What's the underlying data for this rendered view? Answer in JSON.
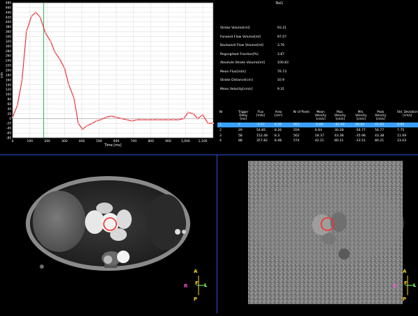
{
  "chart_data": {
    "type": "line",
    "title": "",
    "xlabel": "Time [ms]",
    "ylabel": "ml/s",
    "xlim": [
      0,
      1160
    ],
    "ylim": [
      -80,
      480
    ],
    "x_ticks": [
      0,
      100,
      200,
      300,
      400,
      500,
      600,
      700,
      800,
      900,
      1000,
      1100
    ],
    "x_tick_labels": [
      "0",
      "100",
      "200",
      "300",
      "400",
      "500",
      "600",
      "700",
      "800",
      "900",
      "1,000",
      "1,100"
    ],
    "y_ticks": [
      -80,
      -60,
      -40,
      -20,
      0,
      20,
      40,
      60,
      80,
      100,
      120,
      140,
      160,
      180,
      200,
      220,
      240,
      260,
      280,
      300,
      320,
      340,
      360,
      380,
      400,
      420,
      440,
      460,
      480
    ],
    "grid": true,
    "marker_time": 180,
    "series": [
      {
        "name": "",
        "color": "#e8222a",
        "x": [
          0,
          28,
          55,
          80,
          110,
          135,
          160,
          190,
          220,
          245,
          270,
          300,
          325,
          355,
          380,
          405,
          430,
          460,
          485,
          510,
          540,
          570,
          600,
          630,
          660,
          690,
          720,
          750,
          780,
          810,
          840,
          870,
          900,
          930,
          960,
          990,
          1015,
          1045,
          1070,
          1100,
          1130,
          1160
        ],
        "y": [
          5,
          55,
          160,
          360,
          425,
          440,
          420,
          355,
          320,
          275,
          250,
          210,
          140,
          85,
          -20,
          -45,
          -30,
          -20,
          -10,
          -5,
          5,
          10,
          5,
          0,
          -5,
          -10,
          -5,
          -5,
          -5,
          -5,
          -5,
          -5,
          -5,
          -5,
          -5,
          0,
          25,
          20,
          0,
          15,
          -20,
          -20
        ]
      }
    ]
  },
  "stats": {
    "column_header": "Roi1",
    "rows": [
      {
        "label": "Stroke Volume[ml]",
        "value": "93.31"
      },
      {
        "label": "Forward Flow Volume[ml]",
        "value": "97.07"
      },
      {
        "label": "Backward Flow Volume[ml]",
        "value": "3.76"
      },
      {
        "label": "Regurgitant Fraction[%]",
        "value": "3.87"
      },
      {
        "label": "Absolute Stroke Volume[ml]",
        "value": "100.83"
      },
      {
        "label": "Mean Flux[ml/s]",
        "value": "79.73"
      },
      {
        "label": "Stroke Distance[cm]",
        "value": "10.9"
      },
      {
        "label": "Mean Velocity[cm/s]",
        "value": "9.31"
      }
    ]
  },
  "table": {
    "headers": [
      "Nr",
      "Trigger\nDelay\n[ms]",
      "Flux\n[ml/s]",
      "Area\n[cm²]",
      "Nr of Pixels",
      "Mean\nVelocity\n[cm/s]",
      "Max.\nVelocity\n[cm/s]",
      "Min.\nVelocity\n[cm/s]",
      "Peak\nVelocity\n[cm/s]",
      "Std. Deviation\n[cm/s]"
    ],
    "rows": [
      [
        "1",
        "0",
        "-5.67",
        "8.29",
        "563",
        "-0.68",
        "-41.92",
        "40.84",
        "41.92",
        "8.95"
      ],
      [
        "2",
        "29",
        "54.85",
        "8.26",
        "559",
        "6.64",
        "30.28",
        "-56.77",
        "56.77",
        "7.75"
      ],
      [
        "3",
        "58",
        "152.48",
        "8.3",
        "562",
        "18.37",
        "43.38",
        "-35.96",
        "43.38",
        "11.69"
      ],
      [
        "4",
        "88",
        "357.82",
        "8.48",
        "574",
        "42.21",
        "80.21",
        "-33.51",
        "80.21",
        "23.03"
      ]
    ]
  },
  "orientation": {
    "top": "A",
    "bottom": "P",
    "left": "R",
    "right": "L",
    "center": "F"
  }
}
